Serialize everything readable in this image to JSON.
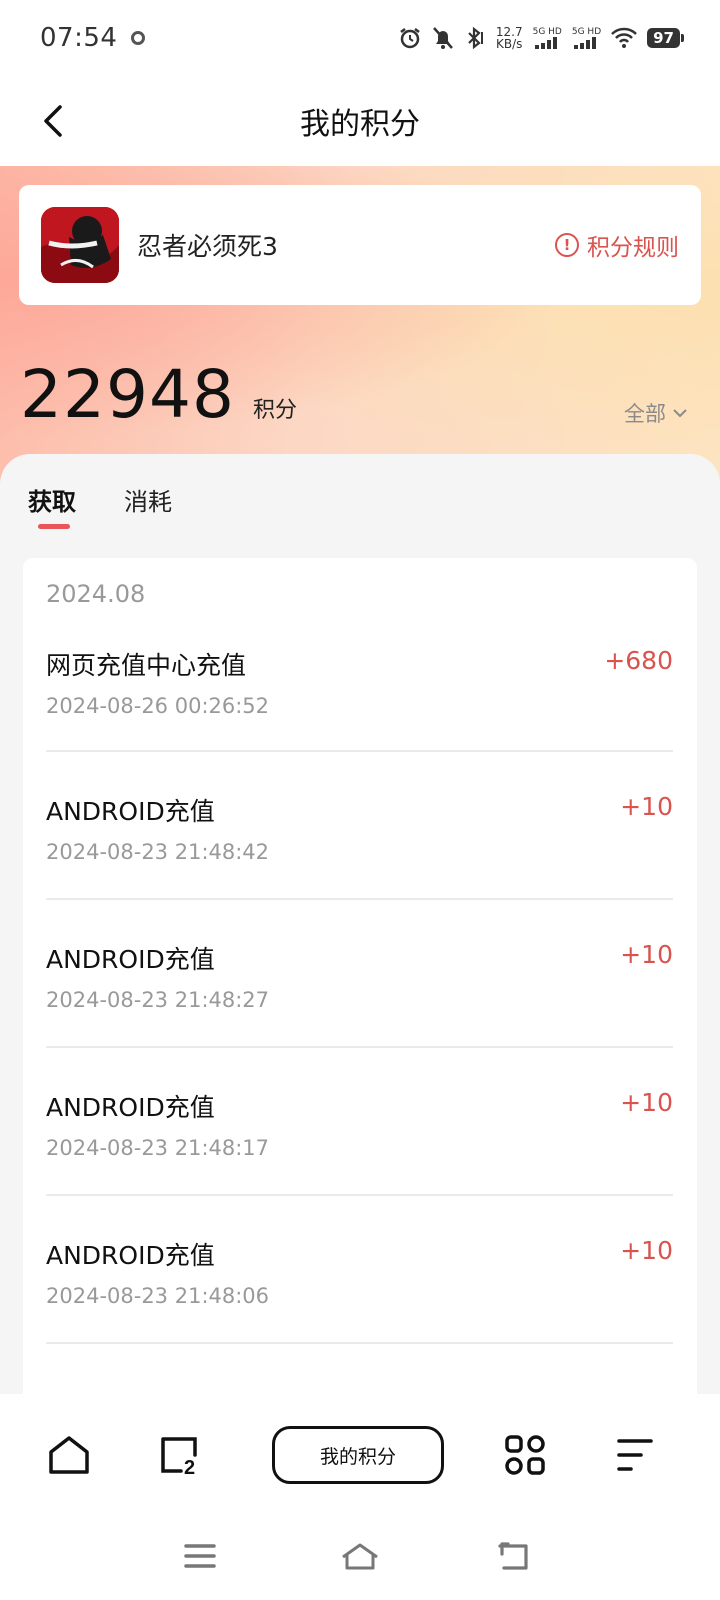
{
  "status_bar": {
    "time": "07:54",
    "net_speed_value": "12.7",
    "net_speed_unit": "KB/s",
    "signal1_label": "5G HD",
    "signal2_label": "5G HD",
    "battery": "97"
  },
  "header": {
    "title": "我的积分"
  },
  "game": {
    "name": "忍者必须死3",
    "rules_label": "积分规则"
  },
  "points": {
    "value": "22948",
    "unit": "积分",
    "filter_label": "全部"
  },
  "tabs": [
    {
      "label": "获取",
      "active": true
    },
    {
      "label": "消耗",
      "active": false
    }
  ],
  "records": {
    "month": "2024.08",
    "items": [
      {
        "title": "网页充值中心充值",
        "time": "2024-08-26 00:26:52",
        "amount": "+680"
      },
      {
        "title": "ANDROID充值",
        "time": "2024-08-23 21:48:42",
        "amount": "+10"
      },
      {
        "title": "ANDROID充值",
        "time": "2024-08-23 21:48:27",
        "amount": "+10"
      },
      {
        "title": "ANDROID充值",
        "time": "2024-08-23 21:48:17",
        "amount": "+10"
      },
      {
        "title": "ANDROID充值",
        "time": "2024-08-23 21:48:06",
        "amount": "+10"
      }
    ]
  },
  "bottom_bar": {
    "center_label": "我的积分",
    "tabs_count": "2",
    "icons": [
      "home-icon",
      "tabs-icon",
      "apps-grid-icon",
      "menu-icon"
    ]
  },
  "nav_bar": {
    "icons": [
      "recents-icon",
      "home-icon",
      "back-icon"
    ]
  },
  "colors": {
    "accent": "#d9534f",
    "panel_bg": "#f5f5f5",
    "muted_text": "#999999"
  }
}
